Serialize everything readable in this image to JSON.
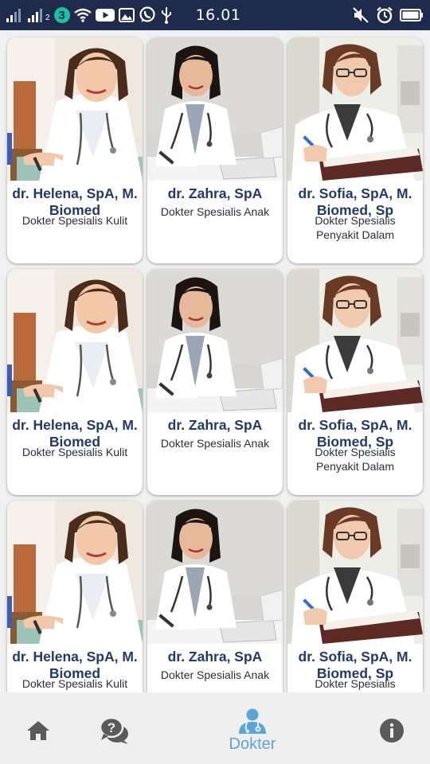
{
  "status_bar": {
    "time": "16.01",
    "network_label": "3",
    "sim_label": "2",
    "left_icons": [
      "signal-icon",
      "signal-icon",
      "network-3-icon",
      "wifi-icon",
      "youtube-icon",
      "gallery-icon",
      "whatsapp-icon",
      "usb-icon"
    ],
    "right_icons": [
      "mute-icon",
      "alarm-icon",
      "battery-icon"
    ]
  },
  "doctors": [
    {
      "name": "dr. Helena, SpA, M. Biomed",
      "specialty": "Dokter Spesialis Kulit",
      "photo": "doctor-helena-photo"
    },
    {
      "name": "dr. Zahra, SpA",
      "specialty": "Dokter Spesialis Anak",
      "photo": "doctor-zahra-photo"
    },
    {
      "name": "dr. Sofia, SpA, M. Biomed, Sp",
      "specialty": "Dokter Spesialis Penyakit Dalam",
      "photo": "doctor-sofia-photo"
    },
    {
      "name": "dr. Helena, SpA, M. Biomed",
      "specialty": "Dokter Spesialis Kulit",
      "photo": "doctor-helena-photo"
    },
    {
      "name": "dr. Zahra, SpA",
      "specialty": "Dokter Spesialis Anak",
      "photo": "doctor-zahra-photo"
    },
    {
      "name": "dr. Sofia, SpA, M. Biomed, Sp",
      "specialty": "Dokter Spesialis Penyakit Dalam",
      "photo": "doctor-sofia-photo"
    },
    {
      "name": "dr. Helena, SpA, M. Biomed",
      "specialty": "Dokter Spesialis Kulit",
      "photo": "doctor-helena-photo"
    },
    {
      "name": "dr. Zahra, SpA",
      "specialty": "Dokter Spesialis Anak",
      "photo": "doctor-zahra-photo"
    },
    {
      "name": "dr. Sofia, SpA, M. Biomed, Sp",
      "specialty": "Dokter Spesialis Penyakit Dalam",
      "photo": "doctor-sofia-photo"
    }
  ],
  "bottom_nav": {
    "items": [
      {
        "icon": "home-icon",
        "label": ""
      },
      {
        "icon": "faq-chat-icon",
        "label": ""
      },
      {
        "icon": "doctor-icon",
        "label": "Dokter",
        "active": true
      },
      {
        "icon": "info-icon",
        "label": ""
      }
    ]
  },
  "colors": {
    "status_bar": "#1f2b4d",
    "doctor_name": "#233a69",
    "active_tab": "#5aa5d8",
    "inactive_icon": "#5a5a5a"
  }
}
